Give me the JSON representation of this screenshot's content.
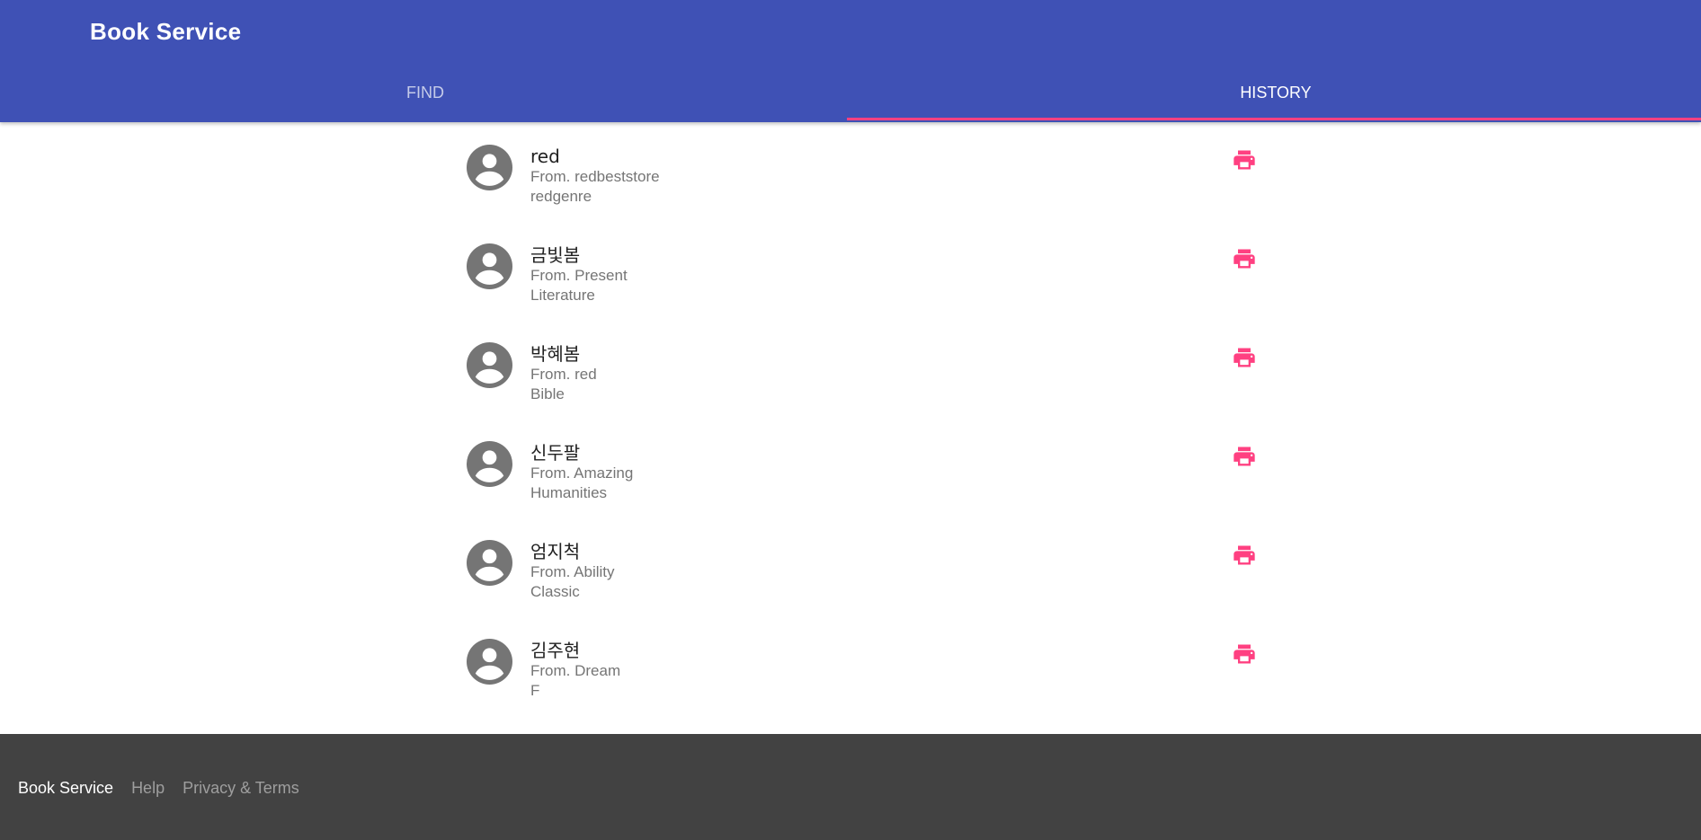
{
  "header": {
    "title": "Book Service",
    "tabs": [
      {
        "label": "FIND",
        "active": false
      },
      {
        "label": "HISTORY",
        "active": true
      }
    ]
  },
  "history": [
    {
      "title": "red",
      "from": "From. redbeststore",
      "genre": "redgenre"
    },
    {
      "title": "금빛봄",
      "from": "From. Present",
      "genre": "Literature"
    },
    {
      "title": "박혜봄",
      "from": "From. red",
      "genre": "Bible"
    },
    {
      "title": "신두팔",
      "from": "From. Amazing",
      "genre": "Humanities"
    },
    {
      "title": "엄지척",
      "from": "From. Ability",
      "genre": "Classic"
    },
    {
      "title": "김주현",
      "from": "From. Dream",
      "genre": "F"
    }
  ],
  "footer": {
    "brand": "Book Service",
    "links": [
      "Help",
      "Privacy & Terms"
    ]
  },
  "icons": {
    "avatar": "account-circle-icon",
    "print": "print-icon"
  },
  "colors": {
    "primary": "#3f51b5",
    "accent": "#ff4081",
    "footer": "#424242",
    "avatar": "#757575"
  }
}
